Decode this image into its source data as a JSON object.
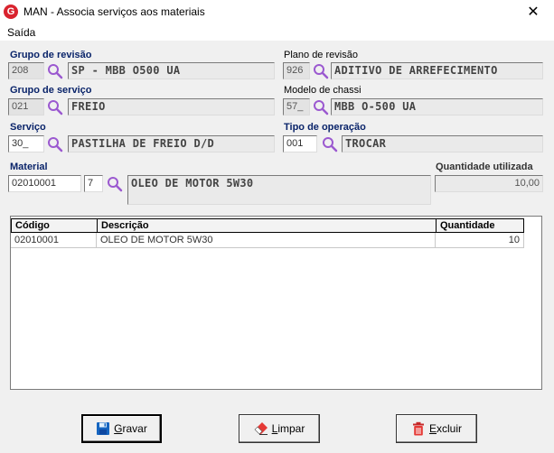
{
  "window": {
    "title": "MAN - Associa serviços aos materiais",
    "close_glyph": "✕"
  },
  "menu": {
    "saida": "Saída"
  },
  "grupo_revisao": {
    "label": "Grupo de revisão",
    "code": "208",
    "desc": "SP - MBB O500 UA"
  },
  "plano_revisao": {
    "label": "Plano de revisão",
    "code": "926",
    "desc": "ADITIVO DE ARREFECIMENTO"
  },
  "grupo_servico": {
    "label": "Grupo de serviço",
    "code": "021",
    "desc": "FREIO"
  },
  "modelo_chassi": {
    "label": "Modelo de chassi",
    "code": "57_",
    "desc": "MBB O-500 UA"
  },
  "servico": {
    "label": "Serviço",
    "code": "30_",
    "desc": "PASTILHA DE FREIO D/D"
  },
  "tipo_operacao": {
    "label": "Tipo de operação",
    "code": "001",
    "desc": "TROCAR"
  },
  "material": {
    "label": "Material",
    "code": "02010001",
    "digit": "7",
    "desc": "OLEO DE MOTOR 5W30"
  },
  "quantidade": {
    "label": "Quantidade utilizada",
    "value": "10,00"
  },
  "table": {
    "headers": [
      "Código",
      "Descrição",
      "Quantidade"
    ],
    "rows": [
      {
        "codigo": "02010001",
        "descricao": "OLEO DE MOTOR 5W30",
        "quantidade": "10"
      }
    ]
  },
  "buttons": {
    "gravar": {
      "mnemonic": "G",
      "rest": "ravar"
    },
    "limpar": {
      "mnemonic": "L",
      "rest": "impar"
    },
    "excluir": {
      "mnemonic": "E",
      "rest": "xcluir"
    }
  },
  "icons": {
    "app": "app-logo-icon",
    "search": "search-icon",
    "save": "floppy-disk-icon",
    "clear": "eraser-icon",
    "delete": "trash-icon"
  }
}
